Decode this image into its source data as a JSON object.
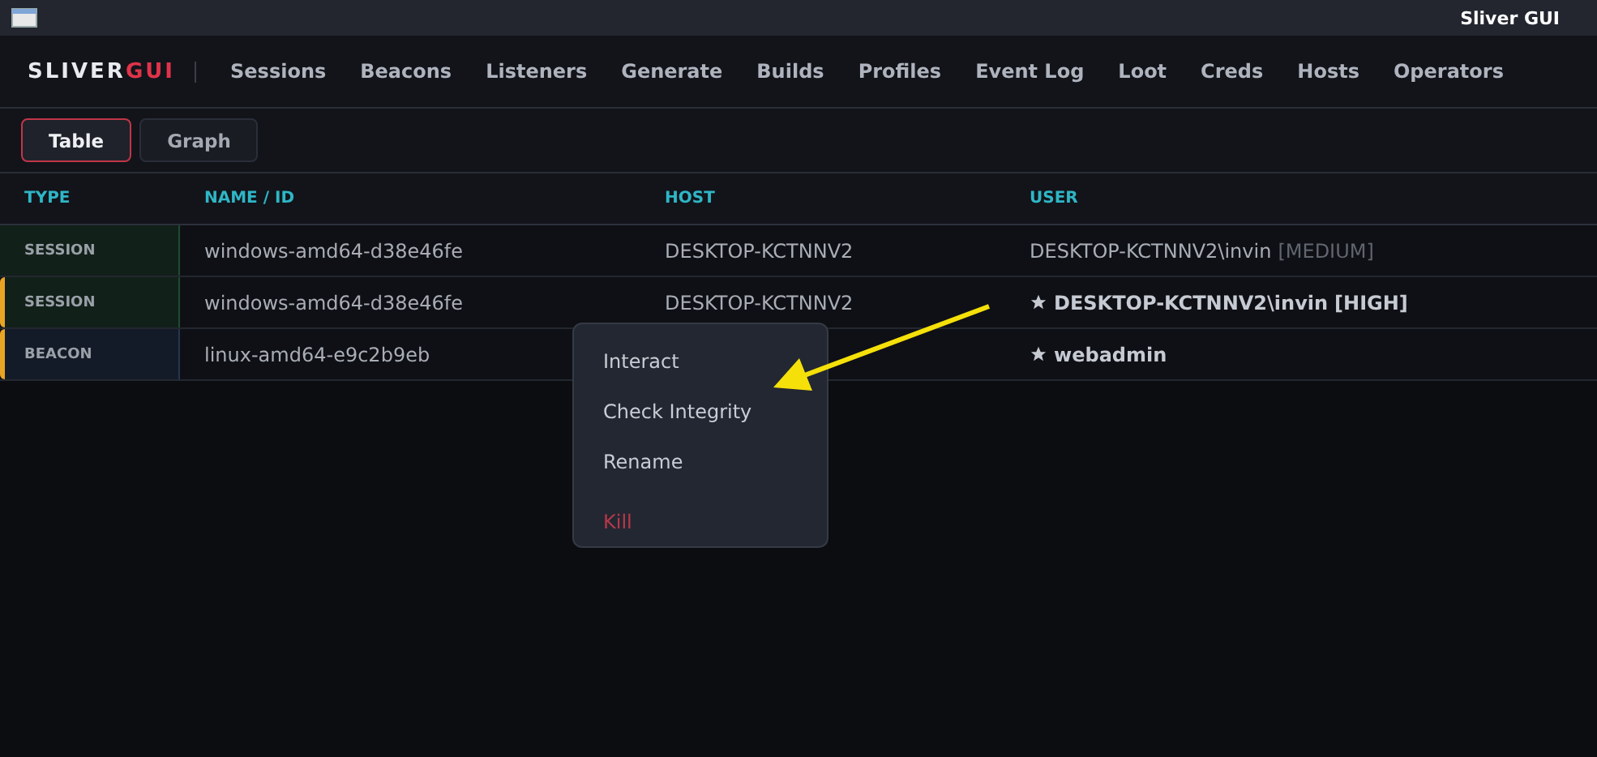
{
  "window": {
    "title": "Sliver GUI"
  },
  "brand": {
    "main": "SLIVER",
    "accent": "GUI"
  },
  "nav": [
    {
      "label": "Sessions"
    },
    {
      "label": "Beacons"
    },
    {
      "label": "Listeners"
    },
    {
      "label": "Generate"
    },
    {
      "label": "Builds"
    },
    {
      "label": "Profiles"
    },
    {
      "label": "Event Log"
    },
    {
      "label": "Loot"
    },
    {
      "label": "Creds"
    },
    {
      "label": "Hosts"
    },
    {
      "label": "Operators"
    }
  ],
  "view_tabs": [
    {
      "label": "Table",
      "selected": true
    },
    {
      "label": "Graph",
      "selected": false
    }
  ],
  "table": {
    "columns": [
      "TYPE",
      "NAME / ID",
      "HOST",
      "USER"
    ],
    "rows": [
      {
        "type": "SESSION",
        "kind": "session",
        "flagged": false,
        "name": "windows-amd64-d38e46fe",
        "host": "DESKTOP-KCTNNV2",
        "user": "DESKTOP-KCTNNV2\\invin",
        "integrity": "[MEDIUM]",
        "starred": false
      },
      {
        "type": "SESSION",
        "kind": "session",
        "flagged": true,
        "name": "windows-amd64-d38e46fe",
        "host": "DESKTOP-KCTNNV2",
        "user": "DESKTOP-KCTNNV2\\invin",
        "integrity": "[HIGH]",
        "starred": true
      },
      {
        "type": "BEACON",
        "kind": "beacon",
        "flagged": true,
        "name": "linux-amd64-e9c2b9eb",
        "user": "webadmin",
        "starred": true
      }
    ]
  },
  "context_menu": [
    {
      "label": "Interact",
      "kind": "action"
    },
    {
      "label": "Check Integrity",
      "kind": "action"
    },
    {
      "label": "Rename",
      "kind": "action"
    },
    {
      "label": "Kill",
      "kind": "danger"
    }
  ]
}
